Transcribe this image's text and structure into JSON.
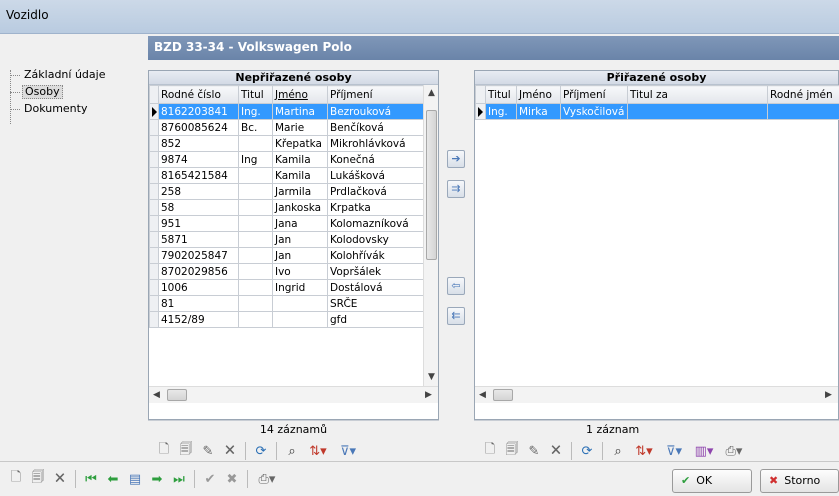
{
  "window": {
    "title": "Vozidlo"
  },
  "tree": {
    "items": [
      {
        "label": "Základní údaje"
      },
      {
        "label": "Osoby"
      },
      {
        "label": "Dokumenty"
      }
    ]
  },
  "header": {
    "title": "BZD 33-34  -  Volkswagen Polo"
  },
  "left_pane": {
    "title": "Nepřiřazené osoby",
    "columns": [
      "Rodné číslo",
      "Titul",
      "Jméno",
      "Příjmení"
    ],
    "rows": [
      [
        "8162203841",
        "Ing.",
        "Martina",
        "Bezrouková"
      ],
      [
        "8760085624",
        "Bc.",
        "Marie",
        "Benčíková"
      ],
      [
        "852",
        "",
        "Křepatka",
        "Mikrohlávková"
      ],
      [
        "9874",
        "Ing",
        "Kamila",
        "Konečná"
      ],
      [
        "8165421584",
        "",
        "Kamila",
        "Lukášková"
      ],
      [
        "258",
        "",
        "Jarmila",
        "Prdlačková"
      ],
      [
        "58",
        "",
        "Jankoska",
        "Krpatka"
      ],
      [
        "951",
        "",
        "Jana",
        "Kolomazníková"
      ],
      [
        "5871",
        "",
        "Jan",
        "Kolodovsky"
      ],
      [
        "7902025847",
        "",
        "Jan",
        "Kolohřívák"
      ],
      [
        "8702029856",
        "",
        "Ivo",
        "Vopršálek"
      ],
      [
        "1006",
        "",
        "Ingrid",
        "Dostálová"
      ],
      [
        "81",
        "",
        "",
        "SRČE"
      ],
      [
        "4152/89",
        "",
        "",
        "gfd"
      ]
    ],
    "count": "14 záznamů"
  },
  "right_pane": {
    "title": "Přiřazené osoby",
    "columns": [
      "Titul",
      "Jméno",
      "Příjmení",
      "Titul za",
      "Rodné jmén"
    ],
    "rows": [
      [
        "Ing.",
        "Mirka",
        "Vyskočilová",
        "",
        ""
      ]
    ],
    "count": "1 záznam"
  },
  "buttons": {
    "ok": "OK",
    "cancel": "Storno"
  },
  "colors": {
    "header": "#6a84a9",
    "selection": "#3399ff"
  }
}
